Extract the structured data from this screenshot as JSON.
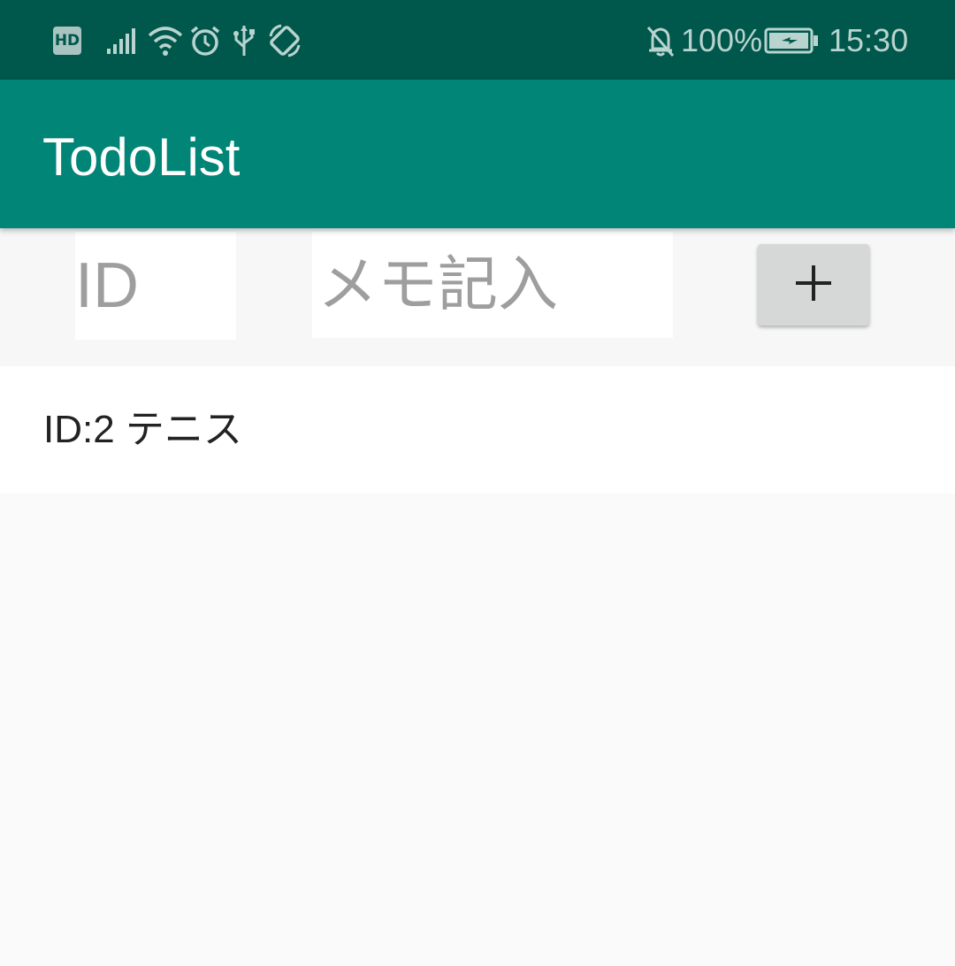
{
  "status_bar": {
    "hd_label": "HD",
    "battery_percent": "100%",
    "time": "15:30",
    "icons": [
      "hd-icon",
      "signal-icon",
      "wifi-icon",
      "alarm-icon",
      "usb-icon",
      "auto-rotate-icon",
      "notifications-off-icon",
      "battery-charging-icon"
    ]
  },
  "app_bar": {
    "title": "TodoList",
    "background_color": "#008577"
  },
  "form": {
    "id_placeholder": "ID",
    "memo_placeholder": "メモ記入",
    "add_button_icon": "plus-icon"
  },
  "todo_list": {
    "items": [
      {
        "label": "ID:2 テニス"
      }
    ]
  }
}
